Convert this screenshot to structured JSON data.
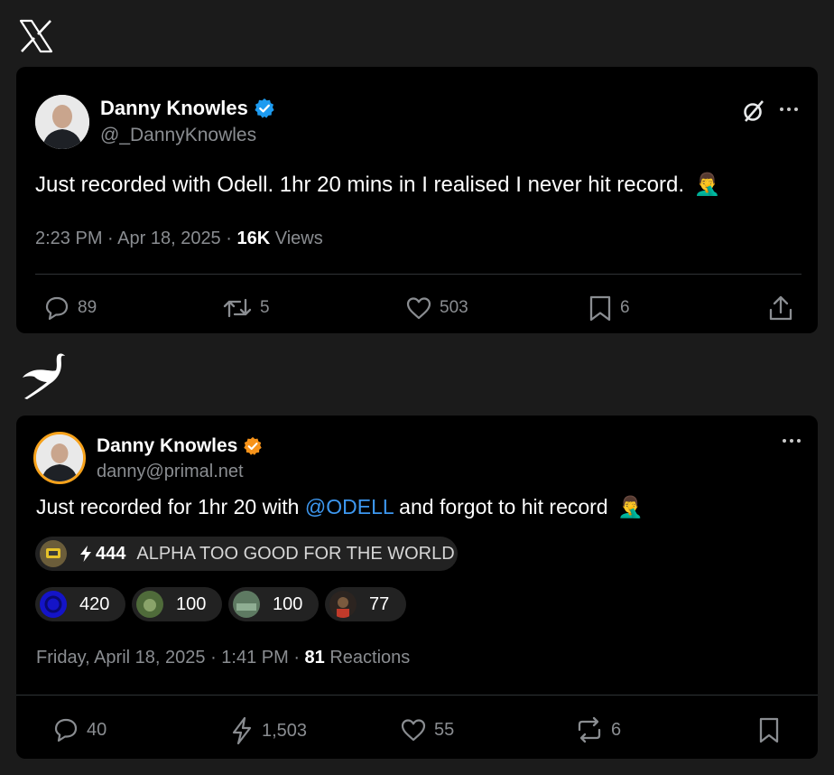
{
  "x_post": {
    "author_name": "Danny Knowles",
    "handle": "@_DannyKnowles",
    "text": "Just recorded with Odell. 1hr 20 mins in I realised I never hit record.",
    "emoji": "🤦‍♂️",
    "time": "2:23 PM · Apr 18, 2025 · ",
    "views_count": "16K",
    "views_label": " Views",
    "replies": "89",
    "reposts": "5",
    "likes": "503",
    "bookmarks": "6"
  },
  "primal_post": {
    "author_name": "Danny Knowles",
    "handle": "danny@primal.net",
    "text_before": "Just recorded for  1hr 20 with ",
    "mention": "@ODELL",
    "text_after": " and forgot to hit record",
    "emoji": "🤦‍♂️",
    "top_zap": {
      "amount": "444",
      "message": "ALPHA TOO GOOD FOR THE WORLD"
    },
    "zaps": [
      "420",
      "100",
      "100",
      "77"
    ],
    "date": "Friday, April 18, 2025 · 1:41 PM · ",
    "reactions_count": "81",
    "reactions_label": " Reactions",
    "replies": "40",
    "zap_total": "1,503",
    "likes": "55",
    "reposts": "6"
  },
  "colors": {
    "background": "#1b1b1b",
    "card": "#000000",
    "verified_x": "#1d9bf0",
    "verified_primal": "#f7931a",
    "mention": "#3d97ef",
    "muted": "#8a8d91"
  }
}
